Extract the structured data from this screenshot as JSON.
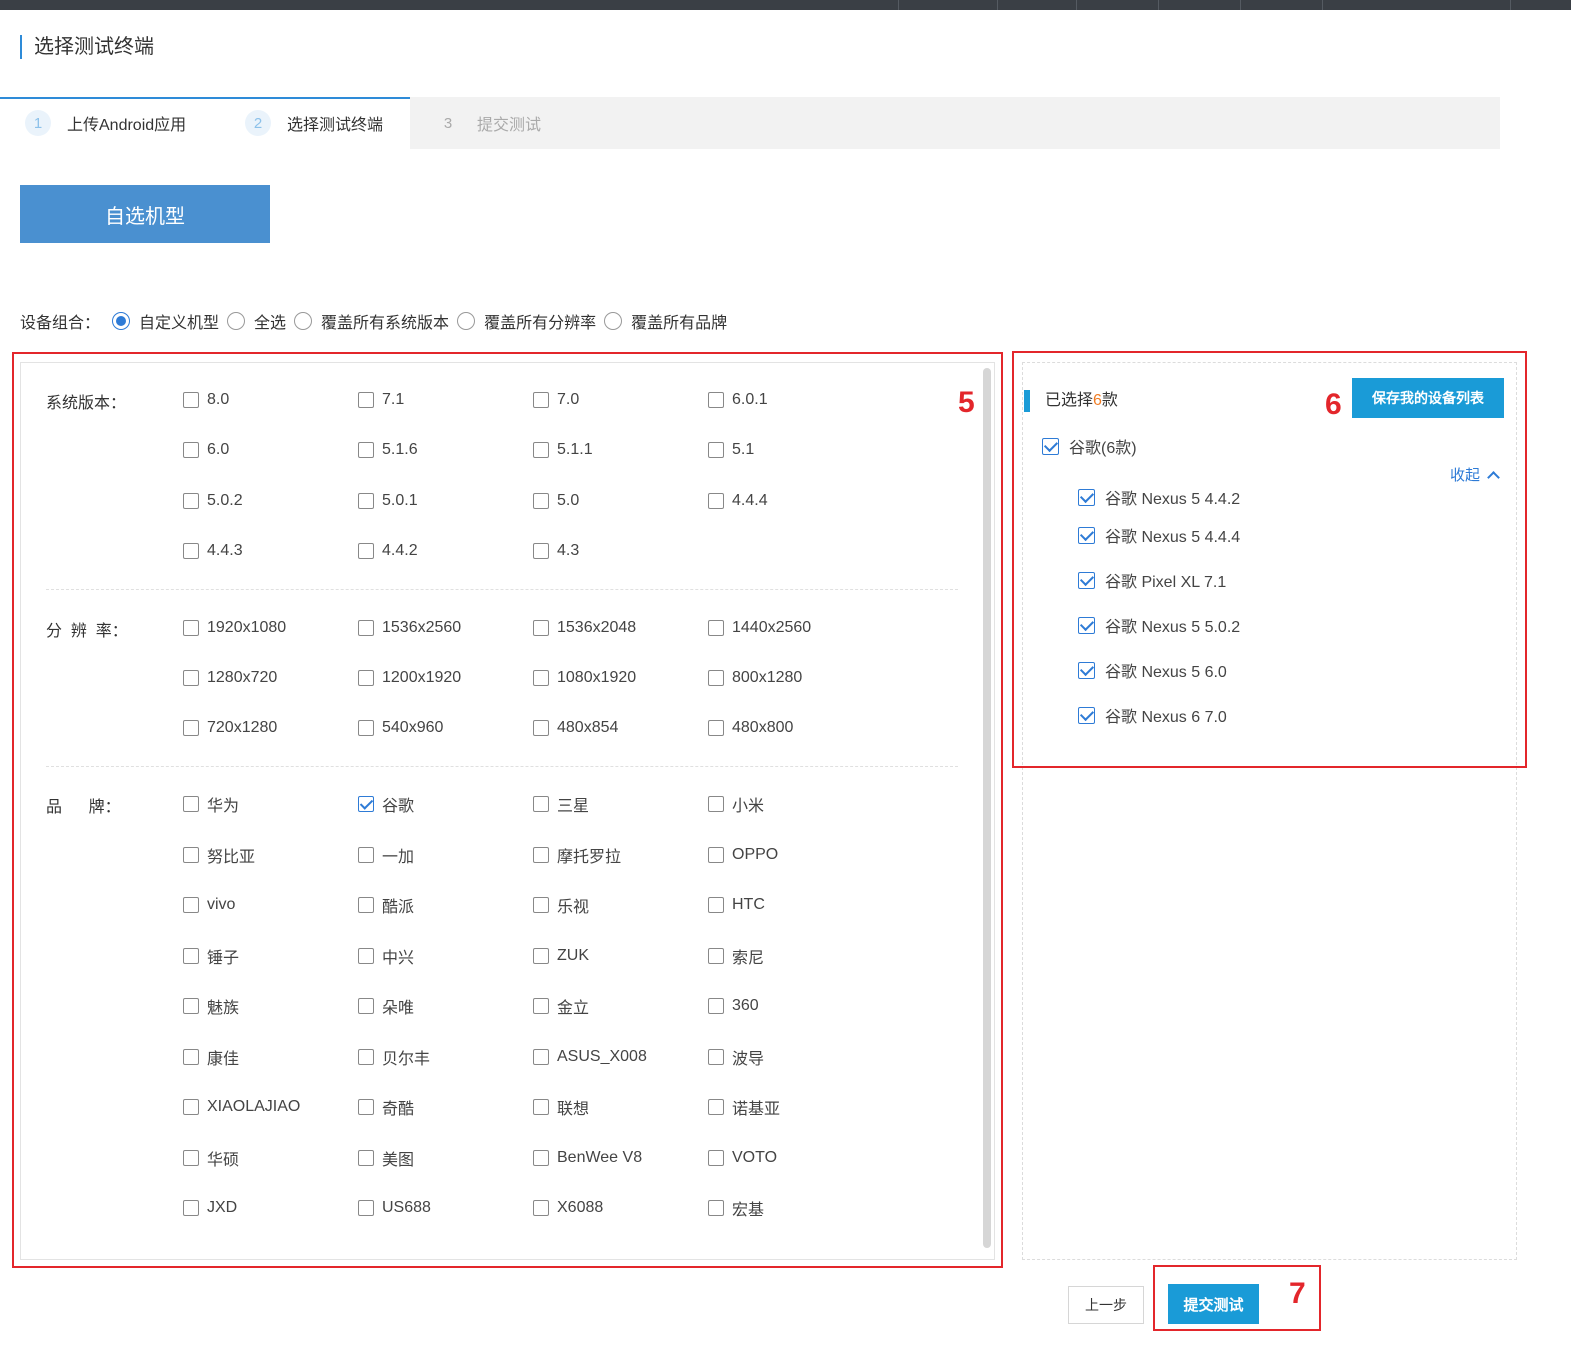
{
  "page_title": "选择测试终端",
  "steps": [
    {
      "num": "1",
      "label": "上传Android应用"
    },
    {
      "num": "2",
      "label": "选择测试终端"
    },
    {
      "num": "3",
      "label": "提交测试"
    }
  ],
  "custom_button": "自选机型",
  "combo": {
    "label": "设备组合：",
    "options": [
      "自定义机型",
      "全选",
      "覆盖所有系统版本",
      "覆盖所有分辨率",
      "覆盖所有品牌"
    ],
    "selected_index": 0
  },
  "filters": {
    "os": {
      "label": "系统版本：",
      "items": [
        "8.0",
        "7.1",
        "7.0",
        "6.0.1",
        "6.0",
        "5.1.6",
        "5.1.1",
        "5.1",
        "5.0.2",
        "5.0.1",
        "5.0",
        "4.4.4",
        "4.4.3",
        "4.4.2",
        "4.3"
      ]
    },
    "resolution": {
      "label": "分  辨  率：",
      "items": [
        "1920x1080",
        "1536x2560",
        "1536x2048",
        "1440x2560",
        "1280x720",
        "1200x1920",
        "1080x1920",
        "800x1280",
        "720x1280",
        "540x960",
        "480x854",
        "480x800"
      ]
    },
    "brand": {
      "label": "品      牌：",
      "items": [
        "华为",
        "谷歌",
        "三星",
        "小米",
        "努比亚",
        "一加",
        "摩托罗拉",
        "OPPO",
        "vivo",
        "酷派",
        "乐视",
        "HTC",
        "锤子",
        "中兴",
        "ZUK",
        "索尼",
        "魅族",
        "朵唯",
        "金立",
        "360",
        "康佳",
        "贝尔丰",
        "ASUS_X008",
        "波导",
        "XIAOLAJIAO",
        "奇酷",
        "联想",
        "诺基亚",
        "华硕",
        "美图",
        "BenWee V8",
        "VOTO",
        "JXD",
        "US688",
        "X6088",
        "宏基"
      ],
      "checked": [
        "谷歌"
      ]
    }
  },
  "selection": {
    "prefix": "已选择",
    "count": "6",
    "suffix": "款",
    "save_button": "保存我的设备列表",
    "group": "谷歌(6款)",
    "collapse": "收起",
    "devices": [
      "谷歌 Nexus 5 4.4.2",
      "谷歌 Nexus 5 4.4.4",
      "谷歌 Pixel XL 7.1",
      "谷歌 Nexus 5 5.0.2",
      "谷歌 Nexus 5 6.0",
      "谷歌 Nexus 6 7.0"
    ]
  },
  "footer": {
    "prev": "上一步",
    "submit": "提交测试"
  },
  "annotations": [
    "5",
    "6",
    "7"
  ],
  "colors": {
    "accent_blue": "#1a9bd7",
    "annotation_red": "#e3262b",
    "count_orange": "#f07c24"
  }
}
